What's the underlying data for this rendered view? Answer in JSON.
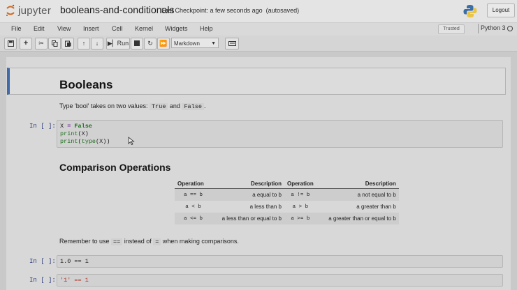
{
  "header": {
    "logo_text": "jupyter",
    "notebook_name": "booleans-and-conditionals",
    "checkpoint": "Last Checkpoint: a few seconds ago",
    "autosave": "(autosaved)",
    "logout_label": "Logout"
  },
  "menu": [
    "File",
    "Edit",
    "View",
    "Insert",
    "Cell",
    "Kernel",
    "Widgets",
    "Help"
  ],
  "status": {
    "trusted": "Trusted",
    "kernel": "Python 3"
  },
  "toolbar": {
    "run_label": "Run",
    "cell_type": "Markdown"
  },
  "notebook": {
    "heading1": "Booleans",
    "intro": {
      "before": "Type 'bool' takes on two values: ",
      "val1": "True",
      "mid": " and ",
      "val2": "False",
      "after": "."
    },
    "cell1": {
      "prompt": "In [ ]:",
      "lines": [
        "X = False",
        "print(X)",
        "print(type(X))"
      ]
    },
    "heading2": "Comparison Operations",
    "table": {
      "headers": [
        "Operation",
        "Description",
        "Operation",
        "Description"
      ],
      "rows": [
        [
          "a == b",
          "a  equal to  b",
          "a  != b",
          "a  not equal to  b"
        ],
        [
          "a < b",
          "a  less than  b",
          "a  >  b",
          "a  greater than  b"
        ],
        [
          "a <= b",
          "a  less than or equal to  b",
          "a  >= b",
          "a  greater than or equal to  b"
        ]
      ]
    },
    "reminder": {
      "before": "Remember to use ",
      "op1": "==",
      "mid": " instead of ",
      "op2": "=",
      "after": " when making comparisons."
    },
    "cell2": {
      "prompt": "In [ ]:",
      "code": "1.0 == 1"
    },
    "cell3": {
      "prompt": "In [ ]:",
      "code": "'1' == 1"
    }
  }
}
